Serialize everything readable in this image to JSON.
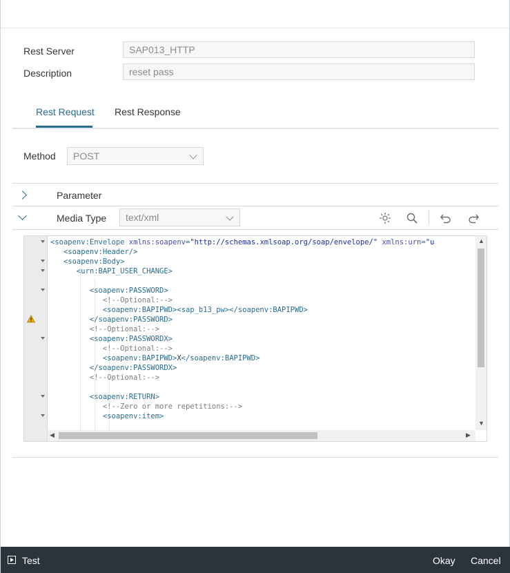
{
  "form": {
    "rest_server_label": "Rest Server",
    "rest_server_value": "SAP013_HTTP",
    "description_label": "Description",
    "description_value": "reset pass"
  },
  "tabs": [
    {
      "label": "Rest Request",
      "active": true
    },
    {
      "label": "Rest Response",
      "active": false
    }
  ],
  "method": {
    "label": "Method",
    "value": "POST"
  },
  "sections": {
    "parameter_label": "Parameter",
    "media_type_label": "Media Type",
    "media_type_value": "text/xml"
  },
  "editor_lines": [
    "<soapenv:Envelope xmlns:soapenv=\"http://schemas.xmlsoap.org/soap/envelope/\" xmlns:urn=\"u",
    "   <soapenv:Header/>",
    "   <soapenv:Body>",
    "      <urn:BAPI_USER_CHANGE>",
    "",
    "         <soapenv:PASSWORD>",
    "            <!--Optional:-->",
    "            <soapenv:BAPIPWD><sap_b13_pw></soapenv:BAPIPWD>",
    "         </soapenv:PASSWORD>",
    "         <!--Optional:-->",
    "         <soapenv:PASSWORDX>",
    "            <!--Optional:-->",
    "            <soapenv:BAPIPWD>X</soapenv:BAPIPWD>",
    "         </soapenv:PASSWORDX>",
    "         <!--Optional:-->",
    "",
    "         <soapenv:RETURN>",
    "            <!--Zero or more repetitions:-->",
    "            <soapenv:item>"
  ],
  "footer": {
    "test_label": "Test",
    "okay_label": "Okay",
    "cancel_label": "Cancel"
  }
}
